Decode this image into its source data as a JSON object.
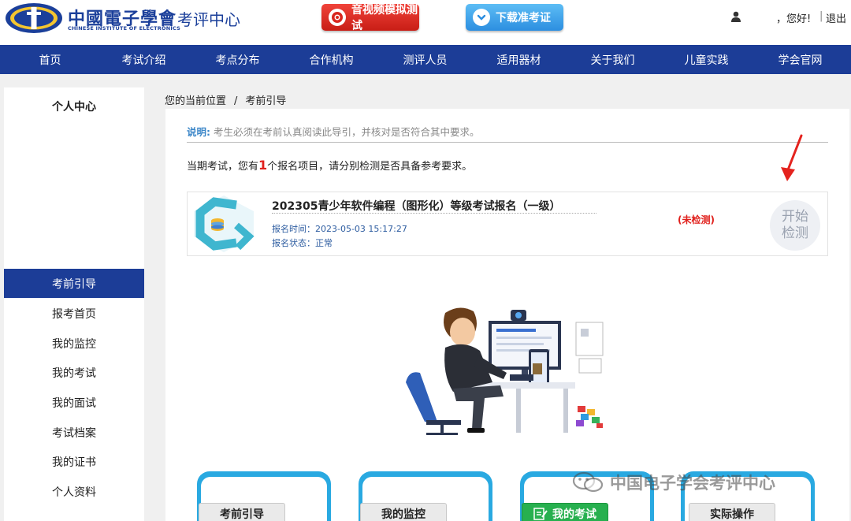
{
  "header": {
    "logo_cn": "中國電子學會",
    "logo_en": "CHINESE INSTITUTE OF ELECTRONICS",
    "logo_sub": "考评中心",
    "av_test_label": "音视频模拟测试",
    "download_label": "下载准考证",
    "greeting": "，您好!",
    "separator": "|",
    "logout": "退出"
  },
  "nav": {
    "items": [
      "首页",
      "考试介绍",
      "考点分布",
      "合作机构",
      "测评人员",
      "适用器材",
      "关于我们",
      "儿童实践",
      "学会官网"
    ]
  },
  "sidebar": {
    "title": "个人中心",
    "items": [
      "考前引导",
      "报考首页",
      "我的监控",
      "我的考试",
      "我的面试",
      "考试档案",
      "我的证书",
      "个人资料"
    ],
    "active_index": 0
  },
  "breadcrumb": {
    "location": "您的当前位置",
    "slash": "/",
    "current": "考前引导"
  },
  "notice": {
    "label": "说明:",
    "text": "考生必须在考前认真阅读此导引，并核对是否符合其中要求。"
  },
  "intro": {
    "prefix": "当期考试，您有",
    "count": "1",
    "suffix": "个报名项目，请分别检测是否具备参考要求。"
  },
  "exam": {
    "title": "202305青少年软件编程（图形化）等级考试报名（一级）",
    "time_label": "报名时间：",
    "time": "2023-05-03 15:17:27",
    "status_label": "报名状态：",
    "status": "正常",
    "check_flag": "(未检测)",
    "check_line1": "开始",
    "check_line2": "检测"
  },
  "cards": {
    "labels": [
      "考前引导",
      "我的监控",
      "我的考试",
      "实际操作"
    ]
  },
  "watermark": "中国电子学会考评中心",
  "colors": {
    "brand_blue": "#1c3d97",
    "accent_red": "#e0201c",
    "card_cyan": "#29a9e1",
    "card_green": "#27b04f"
  }
}
